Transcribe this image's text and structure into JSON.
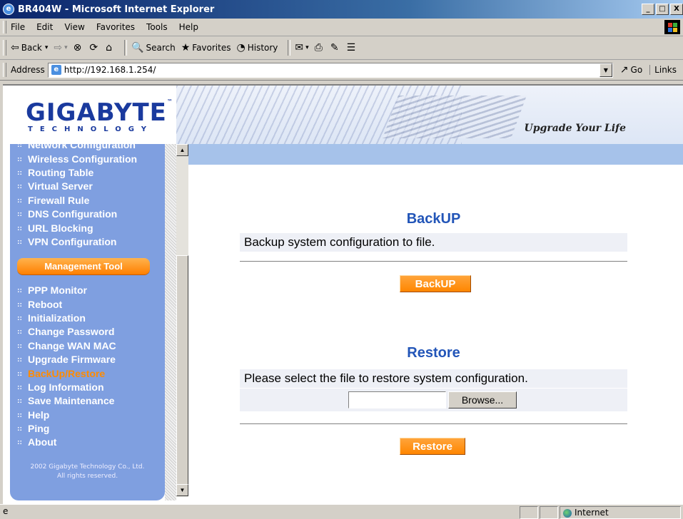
{
  "window": {
    "title": "BR404W - Microsoft Internet Explorer",
    "buttons": [
      "_",
      "□",
      "X"
    ]
  },
  "menu": {
    "items": [
      "File",
      "Edit",
      "View",
      "Favorites",
      "Tools",
      "Help"
    ]
  },
  "toolbar": {
    "back": "Back",
    "search": "Search",
    "favorites": "Favorites",
    "history": "History"
  },
  "address": {
    "label": "Address",
    "url": "http://192.168.1.254/",
    "go": "Go",
    "links": "Links"
  },
  "header": {
    "logo": "GIGABYTE",
    "logo_sub": "TECHNOLOGY",
    "tagline": "Upgrade Your Life"
  },
  "sidebar": {
    "items_top": [
      "Network Configuration",
      "Wireless Configuration",
      "Routing Table",
      "Virtual Server",
      "Firewall Rule",
      "DNS Configuration",
      "URL Blocking",
      "VPN Configuration"
    ],
    "section": "Management Tool",
    "items_mgmt": [
      "PPP Monitor",
      "Reboot",
      "Initialization",
      "Change Password",
      "Change WAN MAC",
      "Upgrade Firmware",
      "BackUp/Restore",
      "Log Information",
      "Save Maintenance",
      "Help",
      "Ping",
      "About"
    ],
    "active": "BackUp/Restore",
    "copyright_line1": "2002 Gigabyte Technology Co., Ltd.",
    "copyright_line2": "All rights reserved."
  },
  "backup": {
    "title": "BackUP",
    "description": "Backup system configuration to file.",
    "button": "BackUP"
  },
  "restore": {
    "title": "Restore",
    "description": "Please select the file to restore system configuration.",
    "file_value": "",
    "browse": "Browse...",
    "button": "Restore"
  },
  "status": {
    "zone": "Internet"
  }
}
